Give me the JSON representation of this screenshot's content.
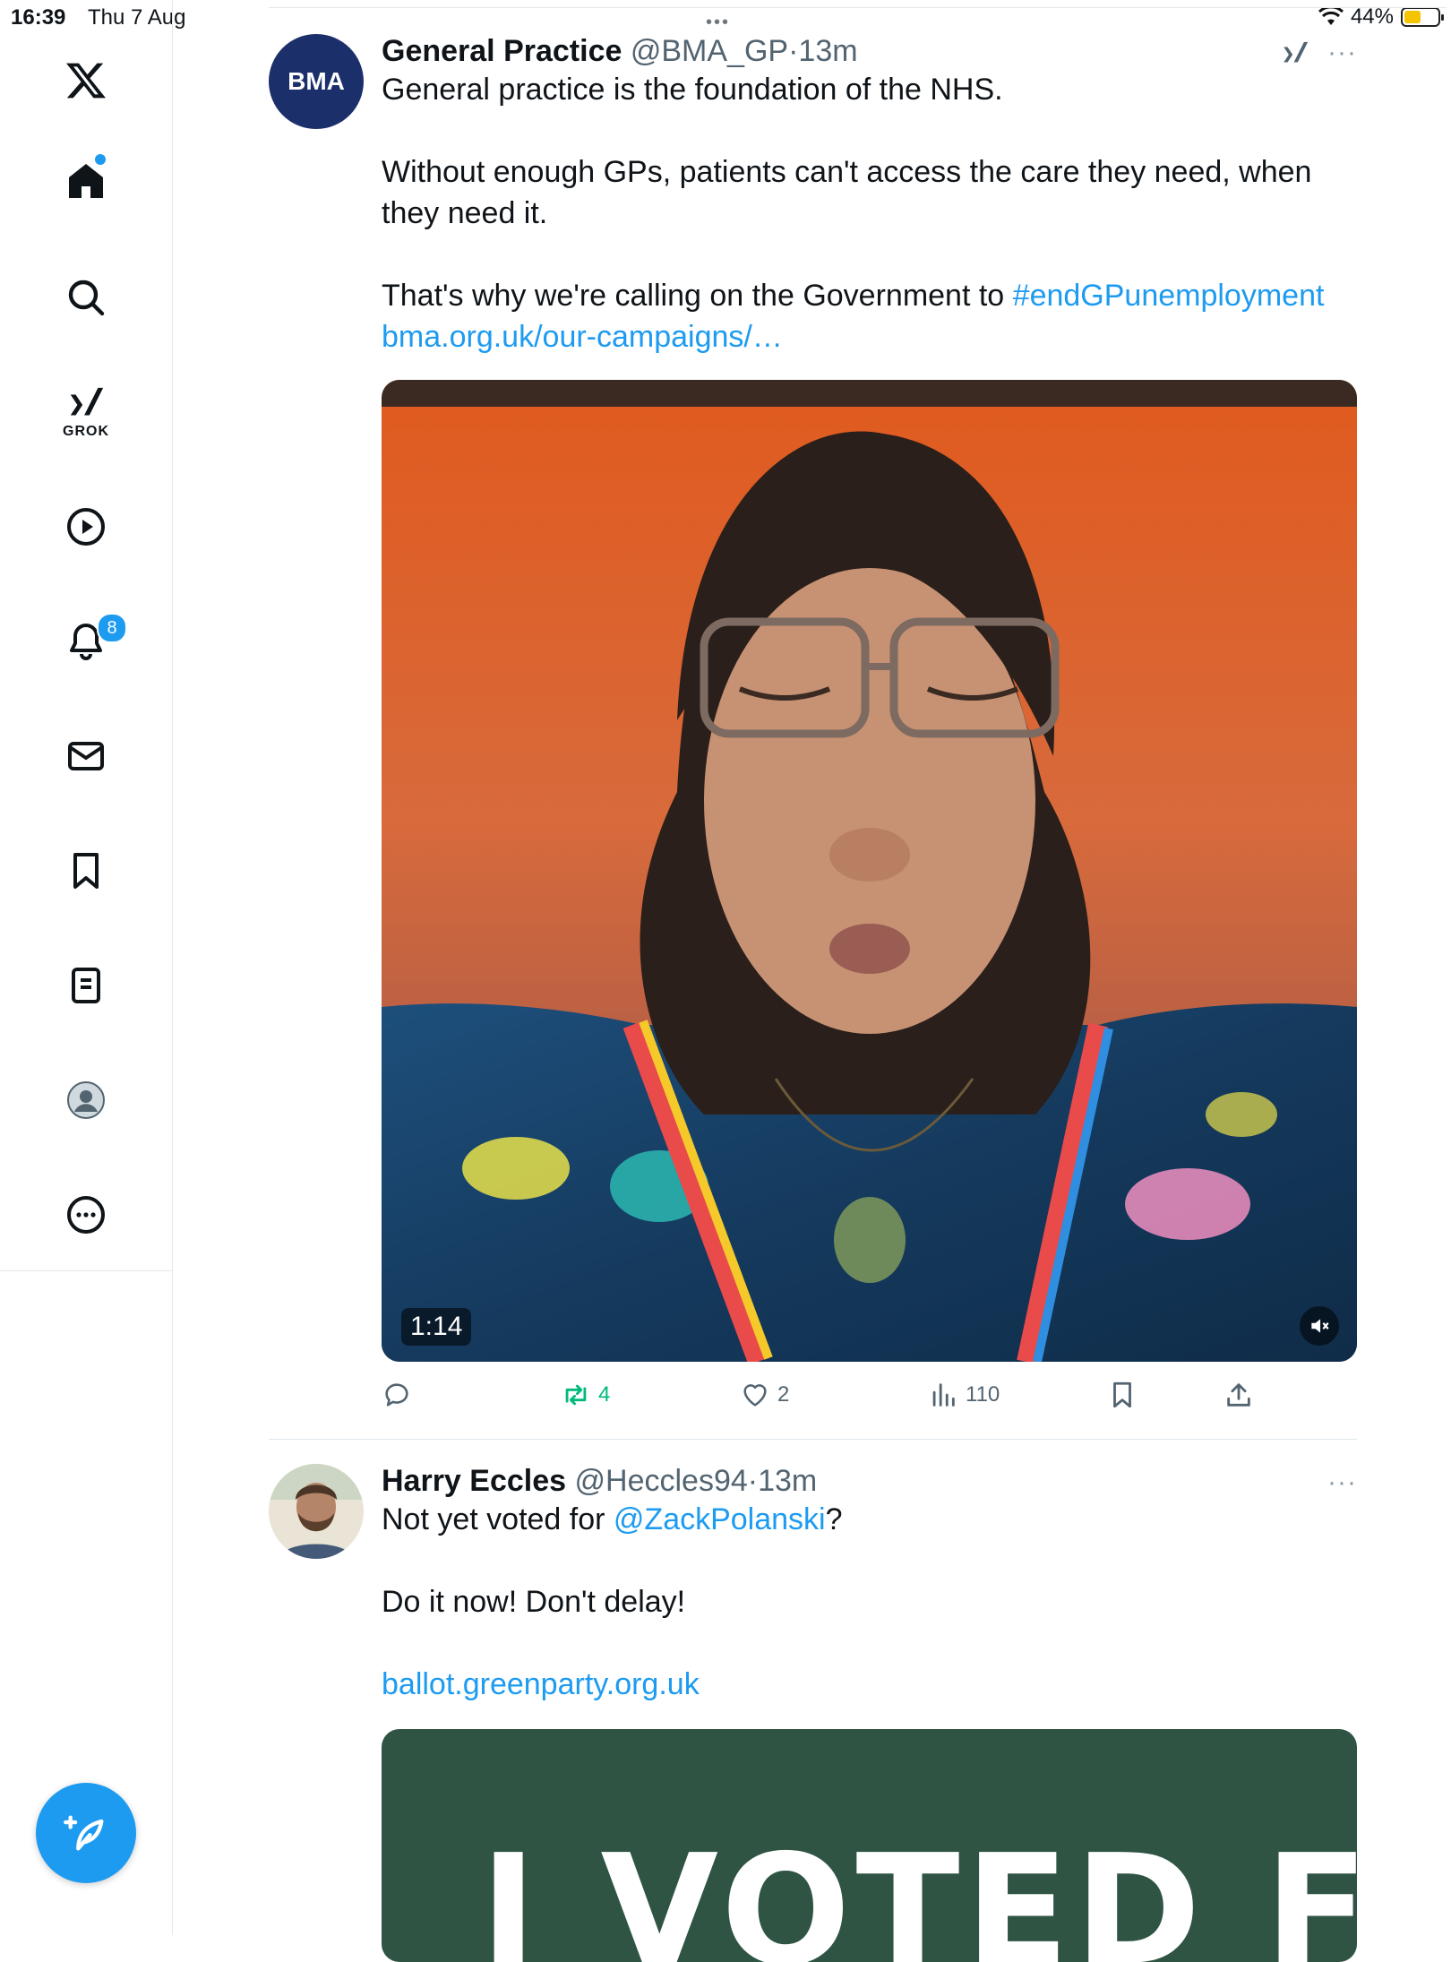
{
  "status_bar": {
    "time": "16:39",
    "date": "Thu 7 Aug",
    "battery": "44%",
    "battery_level": 0.44
  },
  "sidebar": {
    "items": [
      {
        "name": "x-logo"
      },
      {
        "name": "home",
        "has_dot": true
      },
      {
        "name": "search"
      },
      {
        "name": "grok",
        "label": "GROK"
      },
      {
        "name": "videos"
      },
      {
        "name": "notifications",
        "badge": "8"
      },
      {
        "name": "messages"
      },
      {
        "name": "bookmarks"
      },
      {
        "name": "lists"
      },
      {
        "name": "profile"
      },
      {
        "name": "more"
      }
    ],
    "accent": "#1d9bf0"
  },
  "tweets": [
    {
      "avatar_text": "BMA",
      "name": "General Practice",
      "handle": "@BMA_GP",
      "time": "13m",
      "paragraphs": [
        "General practice is the foundation of the NHS.",
        "Without enough GPs, patients can't access the care they need, when they need it.",
        "That's why we're calling on the Government to "
      ],
      "hashtag": "#endGPunemployment",
      "link": "bma.org.uk/our-campaigns/…",
      "video_duration": "1:14",
      "stats": {
        "replies": "",
        "retweets": "4",
        "likes": "2",
        "views": "110"
      }
    },
    {
      "name": "Harry Eccles",
      "handle": "@Heccles94",
      "time": "13m",
      "text_before_mention": "Not yet voted for ",
      "mention": "@ZackPolanski",
      "text_after_mention": "?",
      "paragraph2": "Do it now! Don't delay!",
      "link": "ballot.greenparty.org.uk",
      "card_text": "I VOTED FOR"
    }
  ]
}
